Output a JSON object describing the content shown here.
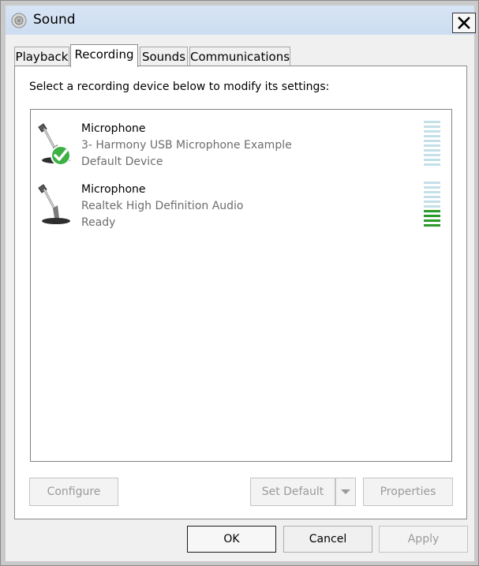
{
  "window": {
    "title": "Sound",
    "close_glyph": "✕"
  },
  "tabs": [
    {
      "label": "Playback",
      "active": false
    },
    {
      "label": "Recording",
      "active": true
    },
    {
      "label": "Sounds",
      "active": false
    },
    {
      "label": "Communications",
      "active": false
    }
  ],
  "panel": {
    "instruction": "Select a recording device below to modify its settings:"
  },
  "devices": [
    {
      "name": "Microphone",
      "description": "3- Harmony USB Microphone Example",
      "status": "Default Device",
      "is_default": true,
      "level_fraction": 0.0,
      "icon": "microphone-icon",
      "badge_icon": "check-badge-icon"
    },
    {
      "name": "Microphone",
      "description": "Realtek High Definition Audio",
      "status": "Ready",
      "is_default": false,
      "level_fraction": 0.4,
      "icon": "microphone-icon",
      "badge_icon": ""
    }
  ],
  "panel_buttons": {
    "configure": "Configure",
    "set_default": "Set Default",
    "properties": "Properties"
  },
  "dialog_buttons": {
    "ok": "OK",
    "cancel": "Cancel",
    "apply": "Apply"
  },
  "colors": {
    "meter_empty": "#c5dfe8",
    "meter_active": "#2a9a2a",
    "badge_green": "#3cb043",
    "titlebar": "#cfdef2"
  }
}
